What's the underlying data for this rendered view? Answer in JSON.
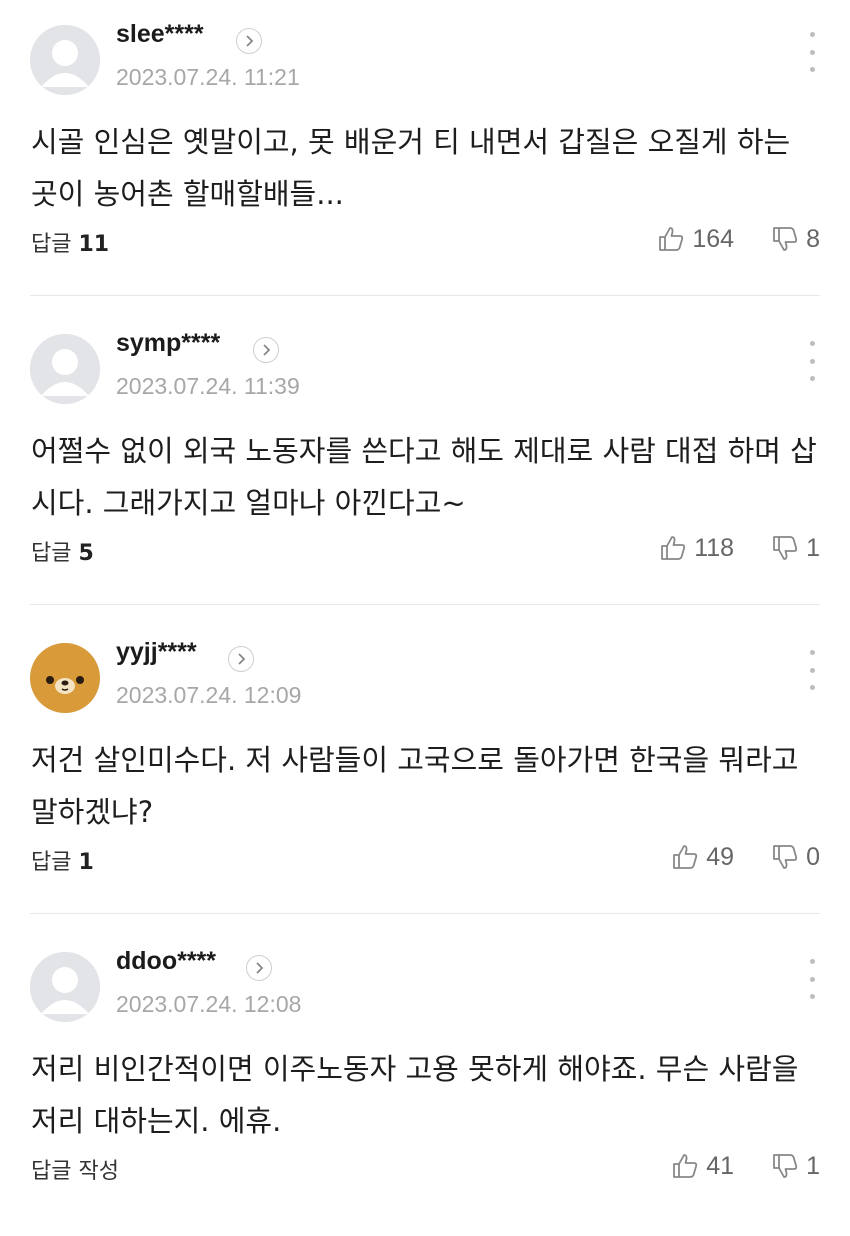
{
  "comments": [
    {
      "nickname": "slee****",
      "date": "2023.07.24. 11:21",
      "text": "시골 인심은 옛말이고, 못 배운거 티 내면서 갑질은 오질게 하는 곳이 농어촌 할매할배들...",
      "reply_label": "답글",
      "reply_count": "11",
      "likes": "164",
      "dislikes": "8",
      "avatar": "default-profile-icon"
    },
    {
      "nickname": "symp****",
      "date": "2023.07.24. 11:39",
      "text": "어쩔수 없이 외국 노동자를 쓴다고 해도 제대로 사람 대접 하며 삽시다. 그래가지고 얼마나 아낀다고~",
      "reply_label": "답글",
      "reply_count": "5",
      "likes": "118",
      "dislikes": "1",
      "avatar": "default-profile-icon"
    },
    {
      "nickname": "yyjj****",
      "date": "2023.07.24. 12:09",
      "text": "저건 살인미수다. 저 사람들이 고국으로 돌아가면 한국을 뭐라고 말하겠냐?",
      "reply_label": "답글",
      "reply_count": "1",
      "likes": "49",
      "dislikes": "0",
      "avatar": "bear-profile-icon"
    },
    {
      "nickname": "ddoo****",
      "date": "2023.07.24. 12:08",
      "text": "저리 비인간적이면 이주노동자 고용 못하게 해야죠. 무슨 사람을 저리 대하는지. 에휴.",
      "reply_label": "답글 작성",
      "reply_count": "",
      "likes": "41",
      "dislikes": "1",
      "avatar": "default-profile-icon"
    }
  ],
  "colors": {
    "text": "#1d1d1d",
    "date": "#a7a7a7",
    "icon": "#bdbdbd",
    "avatar_bg": "#e3e4e8",
    "bear_face": "#d99a3a"
  }
}
